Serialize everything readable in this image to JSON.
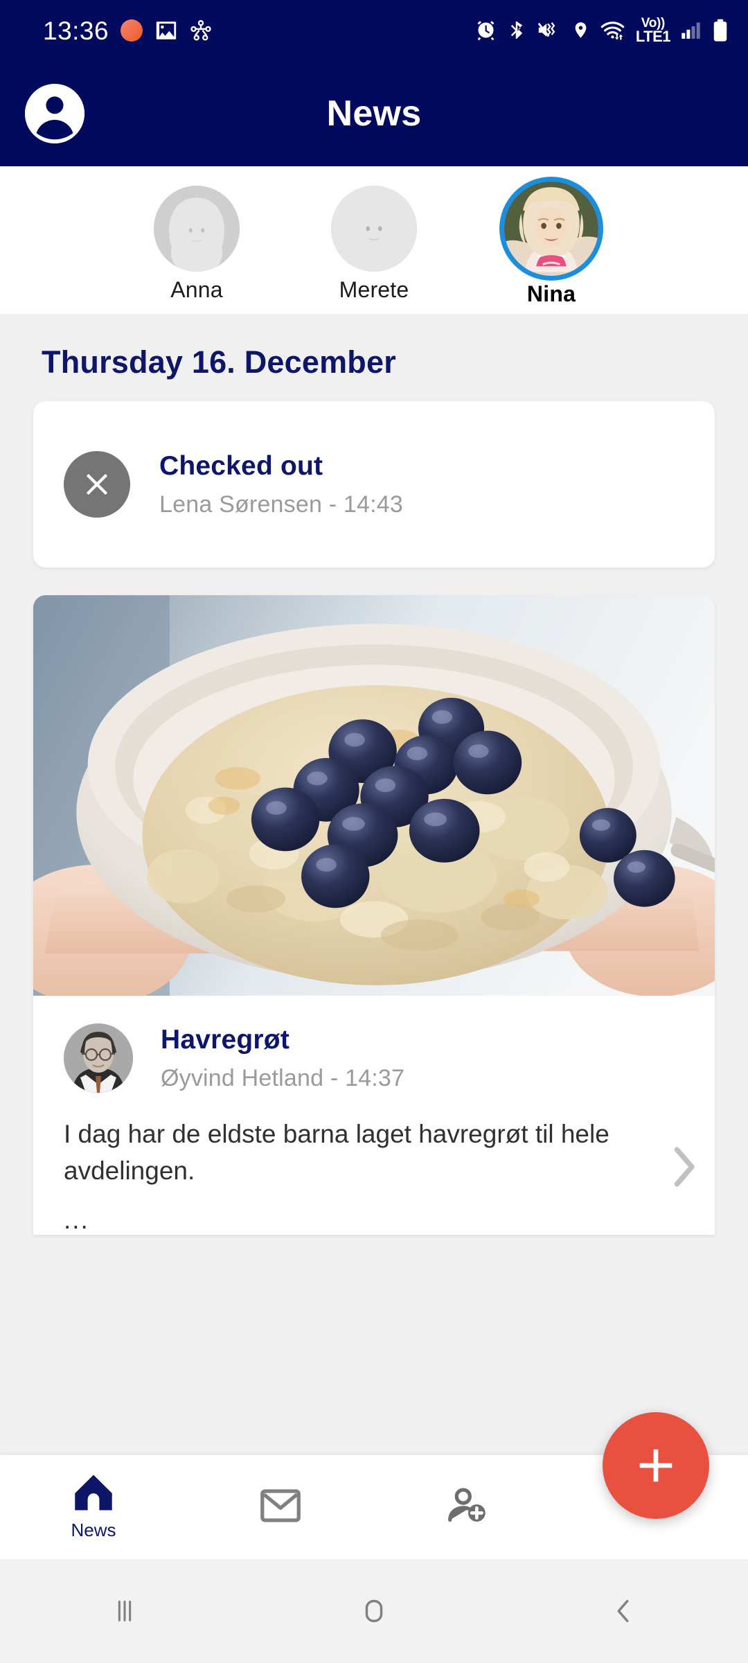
{
  "statusbar": {
    "time": "13:36",
    "left_icons": [
      "notification-dot-icon",
      "photos-icon",
      "share-nodes-icon"
    ],
    "right_icons": [
      "alarm-icon",
      "bluetooth-icon",
      "mute-vibrate-icon",
      "location-icon",
      "wifi-icon",
      "signal-icon",
      "battery-icon"
    ],
    "volte_line1": "Vo))",
    "volte_line2": "LTE1",
    "bg_color": "#020a5e"
  },
  "appbar": {
    "title": "News",
    "avatar_icon": "account-circle-icon",
    "bg_color": "#020a5e"
  },
  "children": {
    "items": [
      {
        "name": "Anna",
        "selected": false
      },
      {
        "name": "Merete",
        "selected": false
      },
      {
        "name": "Nina",
        "selected": true
      }
    ],
    "selected_ring_color": "#1a8fe0"
  },
  "feed": {
    "day_title": "Thursday 16. December",
    "checkout": {
      "icon": "close-circle-icon",
      "title": "Checked out",
      "subtitle": "Lena Sørensen - 14:43"
    },
    "post": {
      "photo_alt": "oatmeal-porridge-with-blueberries-photo",
      "title": "Havregrøt",
      "subtitle": "Øyvind Hetland - 14:37",
      "body": "I dag har de eldste barna laget havregrøt til hele avdelingen.",
      "ellipsis": "...",
      "expand_icon": "chevron-right-icon"
    }
  },
  "bottomnav": {
    "items": [
      {
        "icon": "home-icon",
        "label": "News",
        "active": true
      },
      {
        "icon": "mail-icon",
        "label": "",
        "active": false
      },
      {
        "icon": "person-add-icon",
        "label": "",
        "active": false
      }
    ],
    "active_color": "#0d1669",
    "inactive_color": "#808080"
  },
  "fab": {
    "icon": "plus-icon",
    "color": "#e8503f"
  },
  "sysnav": {
    "buttons": [
      "recents-icon",
      "home-square-icon",
      "back-icon"
    ]
  }
}
